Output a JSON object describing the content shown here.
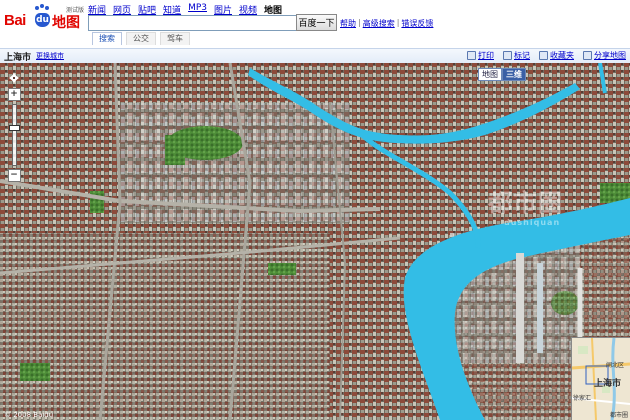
{
  "header": {
    "logo_text": "Bai",
    "logo_du": "du",
    "logo_map": "地图",
    "beta_label": "测试版",
    "nav": [
      "新闻",
      "网页",
      "贴吧",
      "知道",
      "MP3",
      "图片",
      "视频",
      "地图"
    ],
    "active_nav": "地图",
    "search_value": "",
    "search_button": "百度一下",
    "help_links": [
      "帮助",
      "高级搜索",
      "错误反馈"
    ],
    "help_sep": "|",
    "tabs": [
      "搜索",
      "公交",
      "驾车"
    ]
  },
  "toolbar": {
    "city": "上海市",
    "change_city": "更换城市",
    "tools": [
      "打印",
      "标记",
      "收藏夹",
      "分享地图"
    ]
  },
  "map": {
    "view_buttons": [
      "地图",
      "三维"
    ],
    "active_view": "三维",
    "watermark_cn": "都市圈",
    "watermark_en": "dushiquan",
    "copyright": "© 2008 Baidu",
    "overview": {
      "city_label": "上海市",
      "label_left": "徐家汇",
      "label_top": "闸北区",
      "copyright": "都市圈"
    },
    "colors": {
      "river": "#33bde6",
      "park": "#4f8f39",
      "rooftop": "#8c4a3a"
    }
  }
}
